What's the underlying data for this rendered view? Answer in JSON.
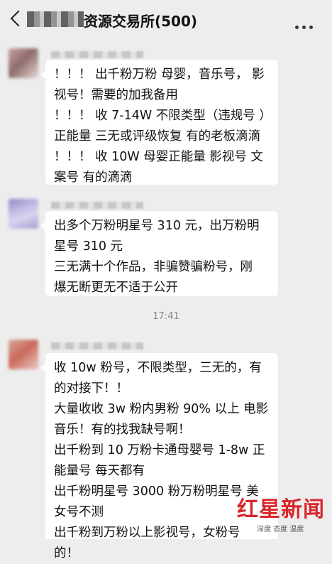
{
  "header": {
    "title": "资源交易所(500)",
    "more_icon": "more-dots-icon"
  },
  "messages": [
    {
      "lines": [
        "！！！ 出千粉万粉 母婴，音乐号， 影",
        "视号！需要的加我备用",
        "！！！ 收 7-14W 不限类型（违规号 ）",
        "正能量 三无或评级恢复 有的老板滴滴",
        "！！！ 收 10W 母婴正能量 影视号 文",
        "案号 有的滴滴"
      ]
    },
    {
      "lines": [
        "出多个万粉明星号 310 元，出万粉明",
        "星号 310 元",
        "三无满十个作品，非骗赞骗粉号，刚",
        "爆无断更无不适于公开"
      ]
    },
    {
      "lines": [
        "收 10w 粉号，不限类型，三无的，有",
        "的对接下！！",
        "大量收收 3w 粉内男粉 90% 以上 电影",
        "音乐！有的找我缺号啊！",
        "出千粉到 10 万粉卡通母婴号 1-8w 正",
        "能量号 每天都有",
        "出千粉明星号 3000 粉万粉明星号  美",
        "女号不测",
        "出千粉到万粉以上影视号，女粉号",
        "的！"
      ]
    }
  ],
  "timestamp": "17:41",
  "watermark": {
    "logo_text": "红星新闻",
    "tagline": "深度 态度 温度",
    "color": "#d8262b"
  },
  "colors": {
    "background": "#ededed",
    "bubble": "#ffffff"
  }
}
